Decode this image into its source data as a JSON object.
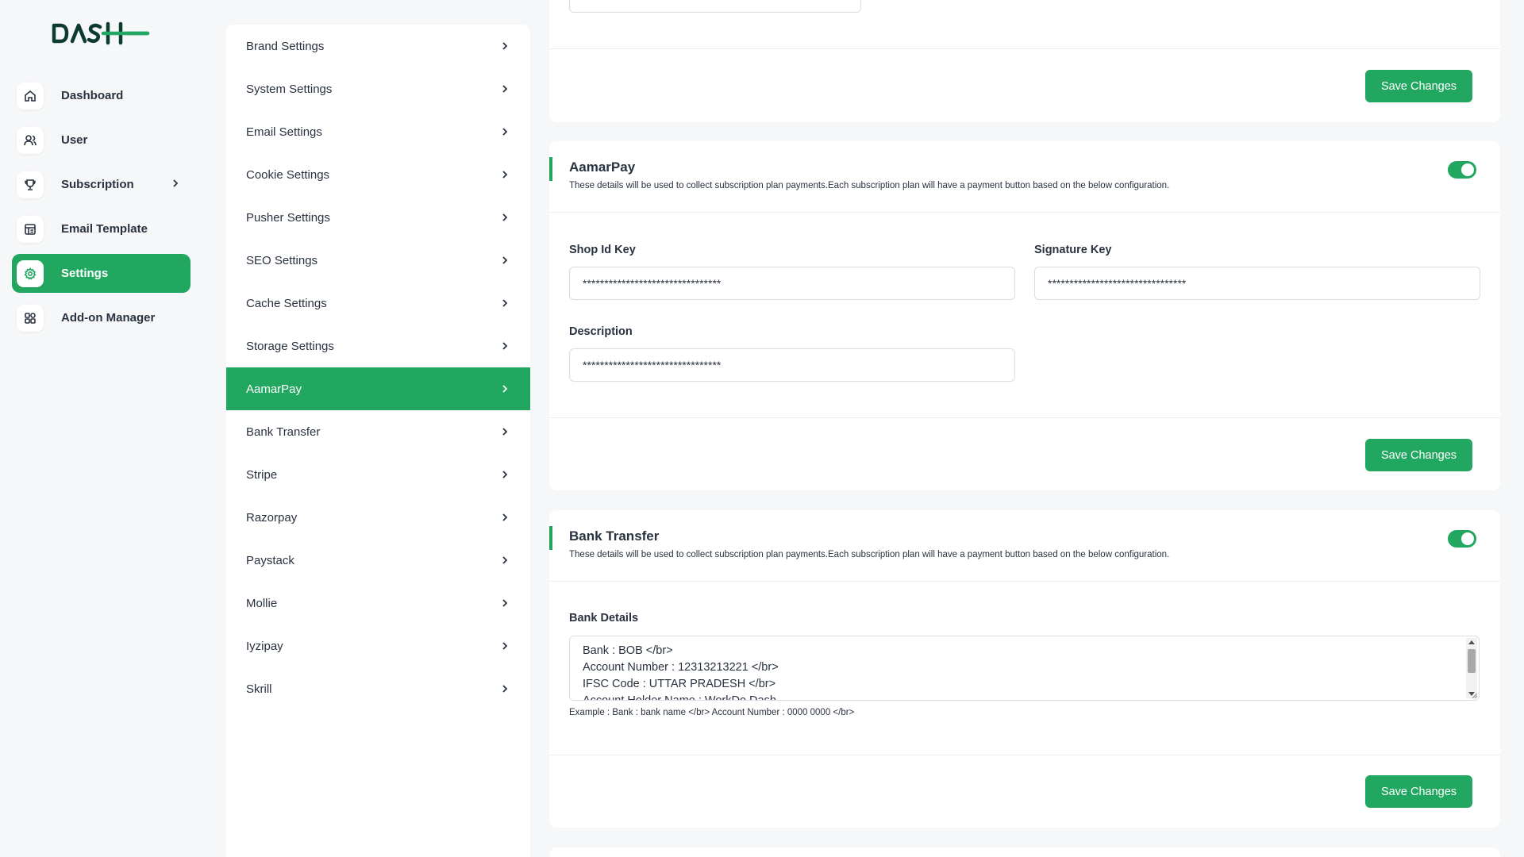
{
  "app": {
    "brand_name": "DASH",
    "brand_color": "#22a760"
  },
  "sidebar": {
    "items": [
      {
        "label": "Dashboard",
        "icon": "home-icon"
      },
      {
        "label": "User",
        "icon": "users-icon"
      },
      {
        "label": "Subscription",
        "icon": "trophy-icon",
        "has_submenu": true
      },
      {
        "label": "Email Template",
        "icon": "template-icon"
      },
      {
        "label": "Settings",
        "icon": "gear-icon",
        "active": true
      },
      {
        "label": "Add-on Manager",
        "icon": "grid-icon"
      }
    ]
  },
  "settings_menu": {
    "items": [
      {
        "label": "Brand Settings"
      },
      {
        "label": "System Settings"
      },
      {
        "label": "Email Settings"
      },
      {
        "label": "Cookie Settings"
      },
      {
        "label": "Pusher Settings"
      },
      {
        "label": "SEO Settings"
      },
      {
        "label": "Cache Settings"
      },
      {
        "label": "Storage Settings"
      },
      {
        "label": "AamarPay",
        "active": true
      },
      {
        "label": "Bank Transfer"
      },
      {
        "label": "Stripe"
      },
      {
        "label": "Razorpay"
      },
      {
        "label": "Paystack"
      },
      {
        "label": "Mollie"
      },
      {
        "label": "Iyzipay"
      },
      {
        "label": "Skrill"
      }
    ]
  },
  "top_card": {
    "save_label": "Save Changes"
  },
  "aamarpay": {
    "title": "AamarPay",
    "description": "These details will be used to collect subscription plan payments.Each subscription plan will have a payment button based on the below configuration.",
    "enabled": true,
    "shop_id_label": "Shop Id Key",
    "shop_id_value": "********************************",
    "signature_label": "Signature Key",
    "signature_value": "********************************",
    "description_label": "Description",
    "description_value": "********************************",
    "save_label": "Save Changes"
  },
  "bank_transfer": {
    "title": "Bank Transfer",
    "description": "These details will be used to collect subscription plan payments.Each subscription plan will have a payment button based on the below configuration.",
    "enabled": true,
    "bank_details_label": "Bank Details",
    "bank_details_lines": [
      "Bank : BOB </br>",
      "Account Number : 12313213221 </br>",
      "IFSC Code : UTTAR PRADESH </br>",
      "Account Holder Name : WorkDo Dash"
    ],
    "example_text": "Example : Bank : bank name </br> Account Number : 0000 0000 </br>",
    "save_label": "Save Changes"
  }
}
